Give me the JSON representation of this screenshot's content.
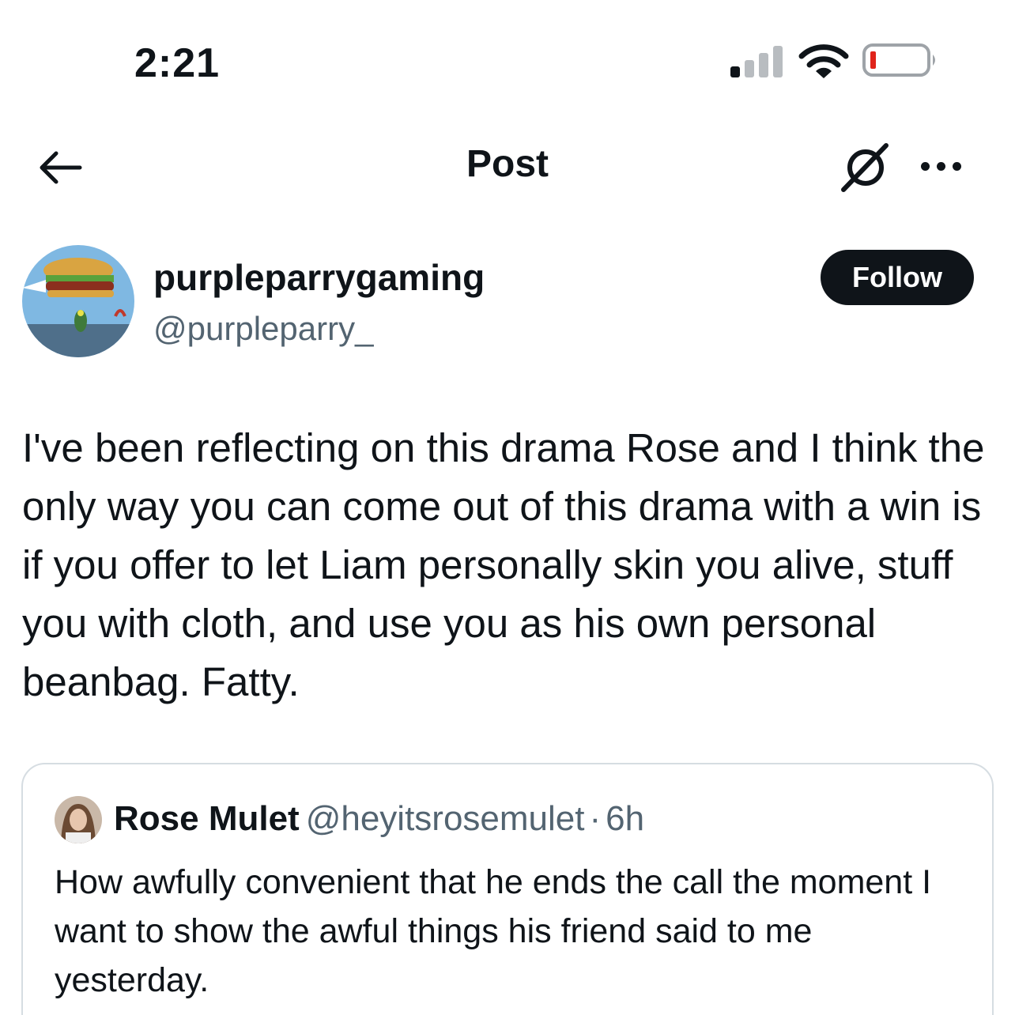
{
  "status_bar": {
    "time": "2:21",
    "icons": [
      "signal-icon",
      "wifi-icon",
      "battery-icon"
    ],
    "battery_color": "#e0241b"
  },
  "nav": {
    "title": "Post",
    "back_icon": "arrow-left-icon",
    "grok_icon": "grok-icon",
    "more_icon": "more-horizontal-icon"
  },
  "author": {
    "display_name": "purpleparrygaming",
    "handle": "@purpleparry_",
    "follow_label": "Follow"
  },
  "post": {
    "text": "I've been reflecting on this drama Rose and I think the only way you can come out of this drama with a win is if you offer to let Liam personally skin you alive, stuff you with cloth, and use you as his own personal beanbag. Fatty."
  },
  "quoted": {
    "display_name": "Rose Mulet",
    "handle": "@heyitsrosemulet",
    "separator": "·",
    "time": "6h",
    "text": "How awfully convenient that he ends the call the moment I want to show the awful things his friend said to me yesterday."
  },
  "colors": {
    "text": "#0f1419",
    "secondary": "#536471",
    "border": "#d6dde2",
    "button": "#0f1419"
  }
}
